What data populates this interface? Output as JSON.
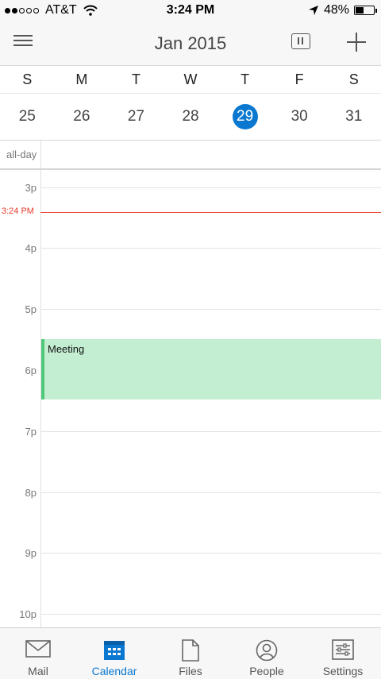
{
  "status_bar": {
    "carrier": "AT&T",
    "time": "3:24 PM",
    "battery": "48%",
    "signal_dots_filled": 2,
    "signal_dots_total": 5
  },
  "nav": {
    "title": "Jan 2015"
  },
  "week": {
    "days": [
      {
        "letter": "S",
        "date": "25"
      },
      {
        "letter": "M",
        "date": "26"
      },
      {
        "letter": "T",
        "date": "27"
      },
      {
        "letter": "W",
        "date": "28"
      },
      {
        "letter": "T",
        "date": "29"
      },
      {
        "letter": "F",
        "date": "30"
      },
      {
        "letter": "S",
        "date": "31"
      }
    ],
    "selected_index": 4
  },
  "allday": {
    "label": "all-day"
  },
  "timeline": {
    "hours": [
      "3p",
      "4p",
      "5p",
      "6p",
      "7p",
      "8p",
      "9p",
      "10p"
    ],
    "now_label": "3:24 PM",
    "event": {
      "title": "Meeting"
    }
  },
  "tabs": [
    {
      "label": "Mail",
      "icon": "mail-icon"
    },
    {
      "label": "Calendar",
      "icon": "calendar-icon",
      "active": true
    },
    {
      "label": "Files",
      "icon": "file-icon"
    },
    {
      "label": "People",
      "icon": "person-icon"
    },
    {
      "label": "Settings",
      "icon": "settings-icon"
    }
  ],
  "colors": {
    "accent": "#0a78d1",
    "now_line": "#e53b2c",
    "event_fill": "#c3eed2",
    "event_bar": "#4fc87a"
  }
}
